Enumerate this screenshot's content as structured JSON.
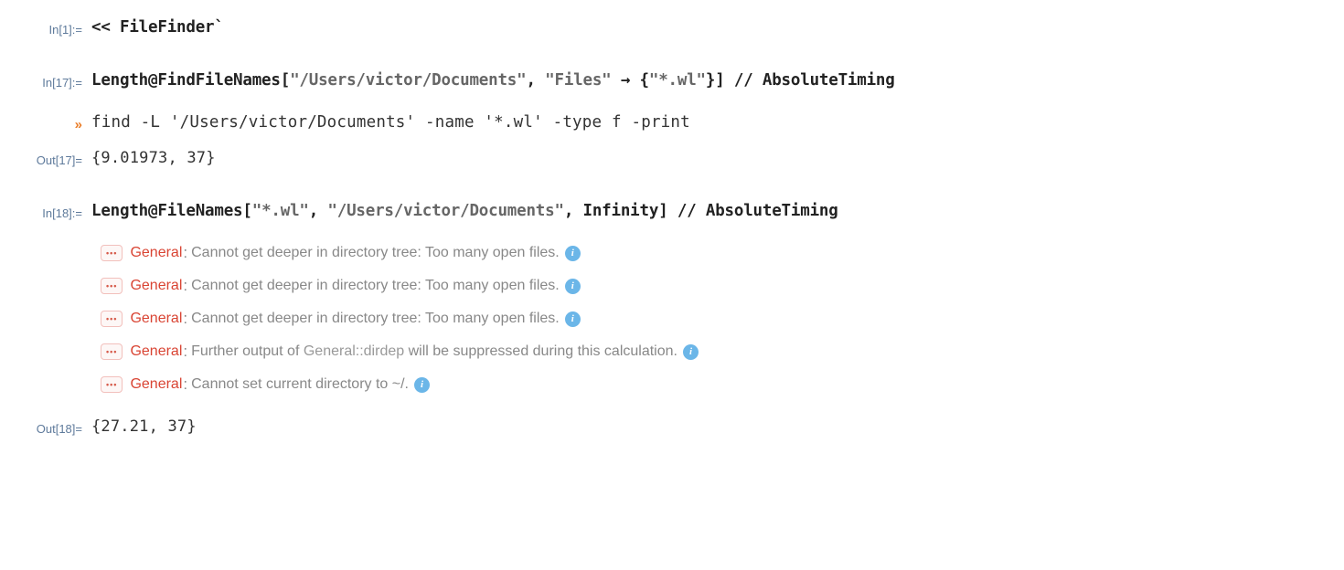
{
  "cells": {
    "in1": {
      "label": "In[1]:=",
      "code_prefix": "<< ",
      "code_main": "FileFinder`"
    },
    "in17": {
      "label": "In[17]:=",
      "parts": {
        "p1": "Length",
        "p2": "@",
        "p3": "FindFileNames",
        "p4": "[",
        "s1": "\"/Users/victor/Documents\"",
        "p5": ", ",
        "s2": "\"Files\"",
        "p6": " → {",
        "s3": "\"*.wl\"",
        "p7": "}] // ",
        "p8": "AbsoluteTiming"
      }
    },
    "echo17": {
      "marker": "»",
      "text": "find -L '/Users/victor/Documents' -name '*.wl' -type f -print"
    },
    "out17": {
      "label": "Out[17]=",
      "value": "{9.01973, 37}"
    },
    "in18": {
      "label": "In[18]:=",
      "parts": {
        "p1": "Length",
        "p2": "@",
        "p3": "FileNames",
        "p4": "[",
        "s1": "\"*.wl\"",
        "p5": ", ",
        "s2": "\"/Users/victor/Documents\"",
        "p6": ", ",
        "p7": "Infinity",
        "p8": "] // ",
        "p9": "AbsoluteTiming"
      }
    },
    "messages": [
      {
        "tag": "General",
        "text": "Cannot get deeper in directory tree: Too many open files."
      },
      {
        "tag": "General",
        "text": "Cannot get deeper in directory tree: Too many open files."
      },
      {
        "tag": "General",
        "text": "Cannot get deeper in directory tree: Too many open files."
      },
      {
        "tag": "General",
        "text_prefix": "Further output of ",
        "suppressed": "General::dirdep",
        "text_suffix": " will be suppressed during this calculation."
      },
      {
        "tag": "General",
        "text": "Cannot set current directory to ~/."
      }
    ],
    "out18": {
      "label": "Out[18]=",
      "value": "{27.21, 37}"
    }
  },
  "icons": {
    "dots": "•••",
    "info": "i"
  }
}
